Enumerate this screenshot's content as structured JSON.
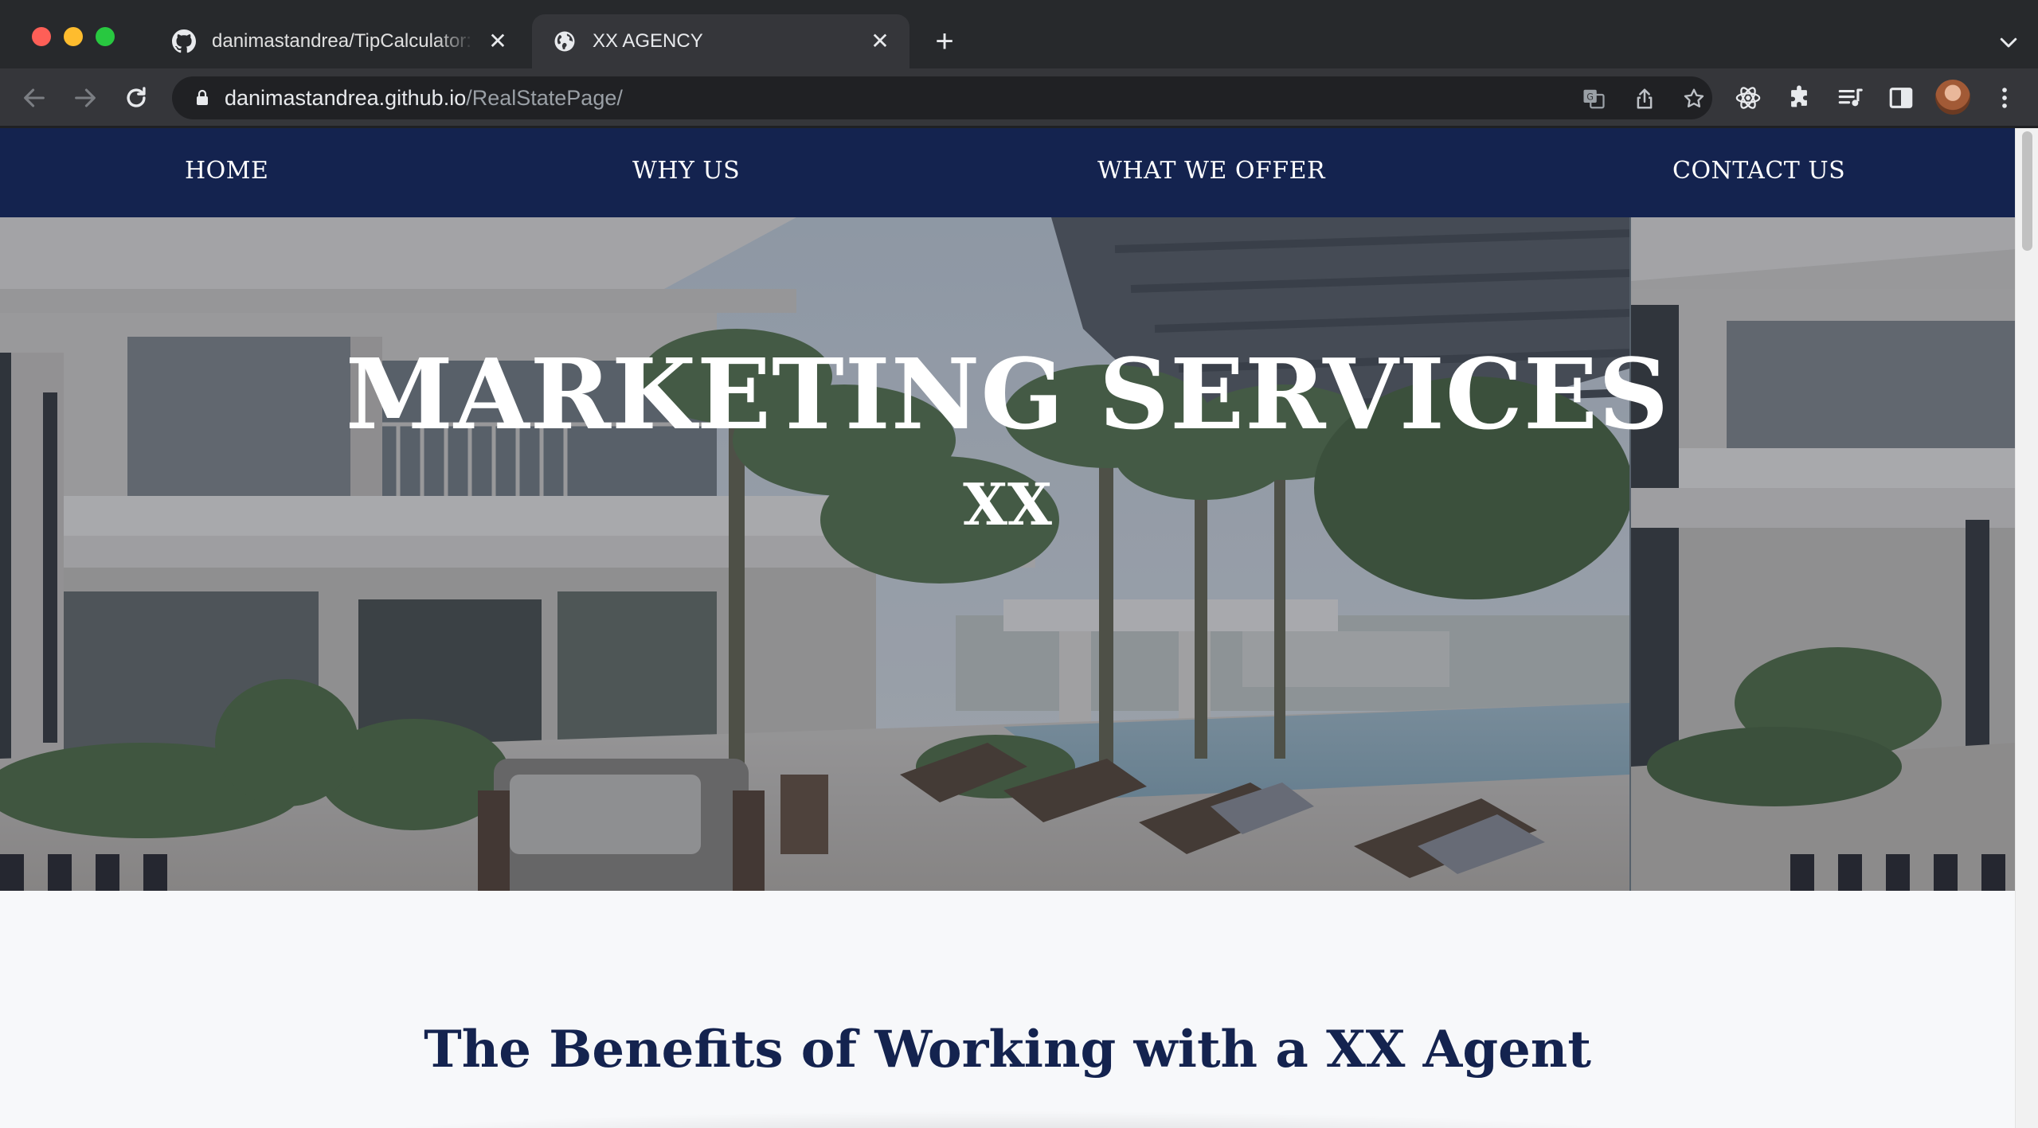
{
  "browser": {
    "tabs": [
      {
        "title": "danimastandrea/TipCalculator: ",
        "favicon": "github-icon",
        "active": false
      },
      {
        "title": "XX AGENCY",
        "favicon": "globe-icon",
        "active": true
      }
    ],
    "address_bar": {
      "host": "danimastandrea.github.io",
      "path": "/RealStatePage/"
    }
  },
  "site": {
    "nav": {
      "home": "HOME",
      "why_us": "WHY US",
      "what_we_offer": "WHAT WE OFFER",
      "contact_us": "CONTACT US"
    },
    "hero": {
      "title": "MARKETING SERVICES",
      "subtitle": "XX"
    },
    "section_title": "The Benefits of Working with a XX Agent"
  },
  "colors": {
    "nav_background": "#14234f",
    "heading_text": "#14234f",
    "page_background": "#f7f8fa"
  }
}
